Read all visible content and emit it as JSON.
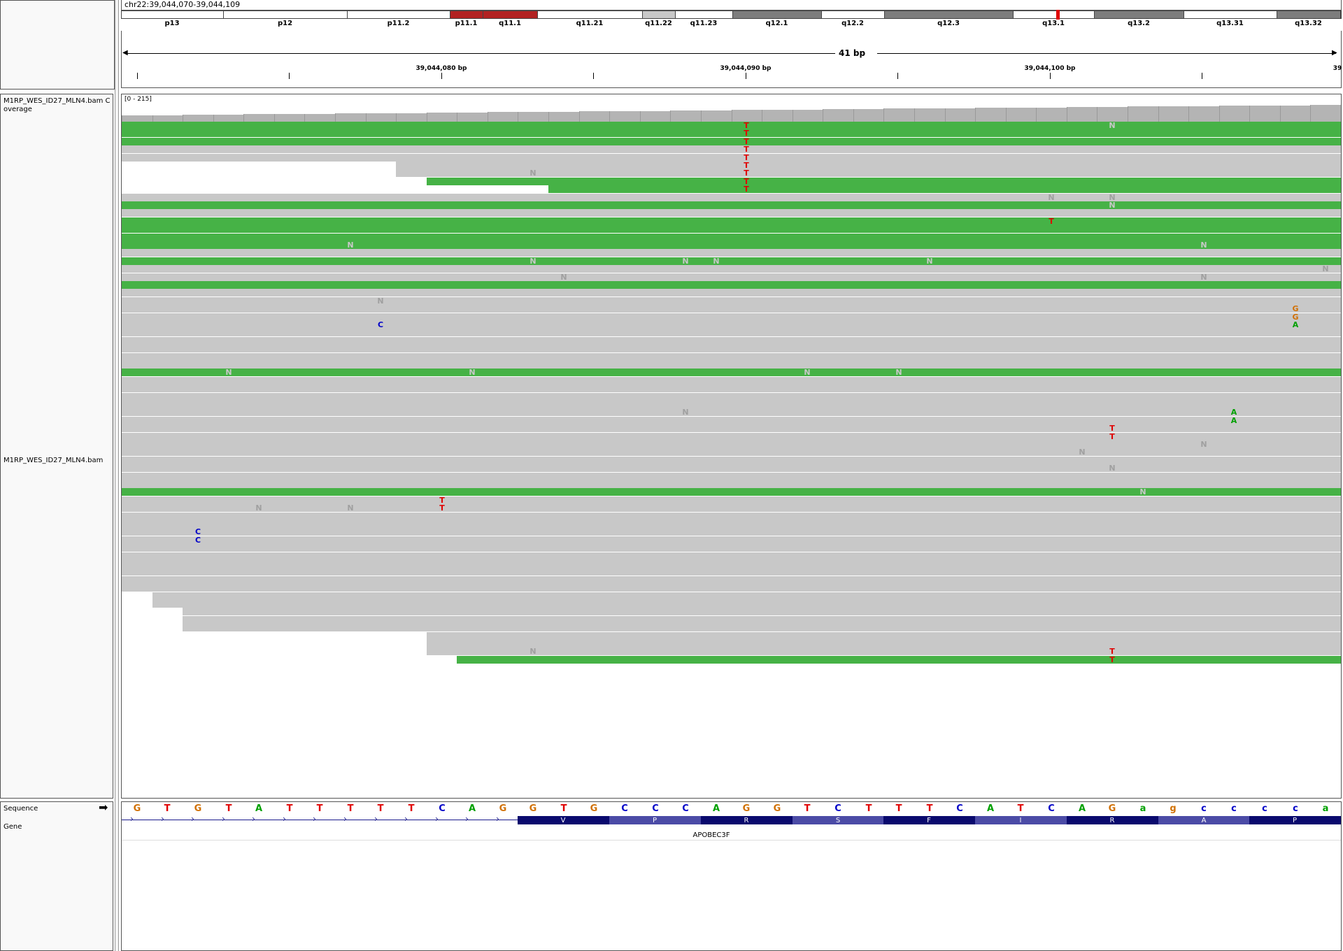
{
  "locus": "chr22:39,044,070-39,044,109",
  "ideogram_bands": [
    {
      "label": "p13",
      "shade": "#ffffff"
    },
    {
      "label": "p12",
      "shade": "#ffffff"
    },
    {
      "label": "p11.2",
      "shade": "#ffffff"
    },
    {
      "label": "p11.1",
      "shade": "#b22222"
    },
    {
      "label": "q11.1",
      "shade": "#b22222"
    },
    {
      "label": "q11.21",
      "shade": "#ffffff"
    },
    {
      "label": "q11.22",
      "shade": "#c8c8c8"
    },
    {
      "label": "q11.23",
      "shade": "#ffffff"
    },
    {
      "label": "q12.1",
      "shade": "#7d7d7d"
    },
    {
      "label": "q12.2",
      "shade": "#ffffff"
    },
    {
      "label": "q12.3",
      "shade": "#7d7d7d"
    },
    {
      "label": "q13.1",
      "shade": "#ffffff"
    },
    {
      "label": "q13.2",
      "shade": "#7d7d7d"
    },
    {
      "label": "q13.31",
      "shade": "#ffffff"
    },
    {
      "label": "q13.32",
      "shade": "#7d7d7d"
    }
  ],
  "ruler": {
    "span_label": "41 bp",
    "ticks": [
      "39,044,080 bp",
      "39,044,090 bp",
      "39,044,100 bp",
      "39"
    ]
  },
  "tracks": {
    "coverage_name": "M1RP_WES_ID27_MLN4.bam Coverage",
    "coverage_range": "[0 - 215]",
    "bam_name": "M1RP_WES_ID27_MLN4.bam",
    "sequence_name": "Sequence",
    "gene_name": "Gene"
  },
  "sequence": [
    "G",
    "T",
    "G",
    "T",
    "A",
    "T",
    "T",
    "T",
    "T",
    "T",
    "C",
    "A",
    "G",
    "G",
    "T",
    "G",
    "C",
    "C",
    "C",
    "A",
    "G",
    "G",
    "T",
    "C",
    "T",
    "T",
    "T",
    "C",
    "A",
    "T",
    "C",
    "A",
    "G",
    "a",
    "g",
    "c",
    "c",
    "c",
    "c",
    "a"
  ],
  "base_colors": {
    "A": "#00a000",
    "C": "#0000c8",
    "G": "#d17105",
    "T": "#e00000",
    "N": "#a0a0a0"
  },
  "gene": {
    "name": "APOBEC3F",
    "amino_acids": [
      "V",
      "P",
      "R",
      "S",
      "F",
      "I",
      "R",
      "A",
      "P"
    ]
  }
}
